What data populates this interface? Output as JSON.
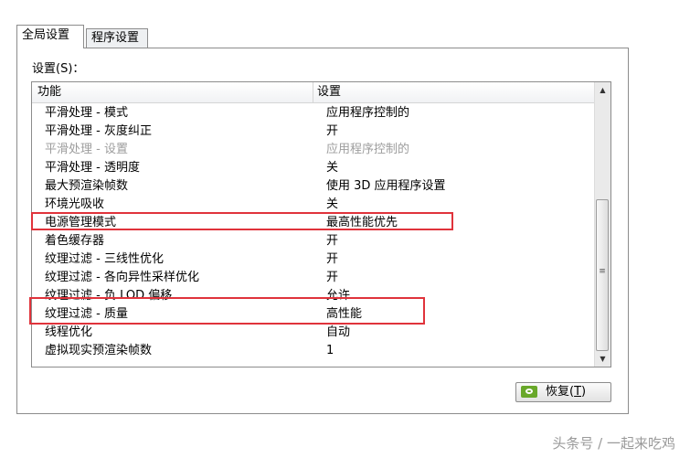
{
  "tabs": [
    {
      "label": "全局设置",
      "active": true
    },
    {
      "label": "程序设置",
      "active": false
    }
  ],
  "settings_label": "设置(S)：",
  "columns": {
    "feature": "功能",
    "setting": "设置"
  },
  "rows": [
    {
      "feature": "平滑处理 - 模式",
      "value": "应用程序控制的",
      "dim": false
    },
    {
      "feature": "平滑处理 - 灰度纠正",
      "value": "开",
      "dim": false
    },
    {
      "feature": "平滑处理 - 设置",
      "value": "应用程序控制的",
      "dim": true
    },
    {
      "feature": "平滑处理 - 透明度",
      "value": "关",
      "dim": false
    },
    {
      "feature": "最大预渲染帧数",
      "value": "使用 3D 应用程序设置",
      "dim": false
    },
    {
      "feature": "环境光吸收",
      "value": "关",
      "dim": false
    },
    {
      "feature": "电源管理模式",
      "value": "最高性能优先",
      "dim": false
    },
    {
      "feature": "着色缓存器",
      "value": "开",
      "dim": false
    },
    {
      "feature": "纹理过滤 - 三线性优化",
      "value": "开",
      "dim": false
    },
    {
      "feature": "纹理过滤 - 各向异性采样优化",
      "value": "开",
      "dim": false
    },
    {
      "feature": "纹理过滤 - 负 LOD 偏移",
      "value": "允许",
      "dim": false
    },
    {
      "feature": "纹理过滤 - 质量",
      "value": "高性能",
      "dim": false
    },
    {
      "feature": "线程优化",
      "value": "自动",
      "dim": false
    },
    {
      "feature": "虚拟现实预渲染帧数",
      "value": "1",
      "dim": false
    }
  ],
  "restore_button": {
    "label": "恢复",
    "shortcut": "T"
  },
  "watermark": "头条号 / 一起来吃鸡",
  "colors": {
    "highlight": "#e0333b",
    "nvidia_green": "#69a82a"
  }
}
